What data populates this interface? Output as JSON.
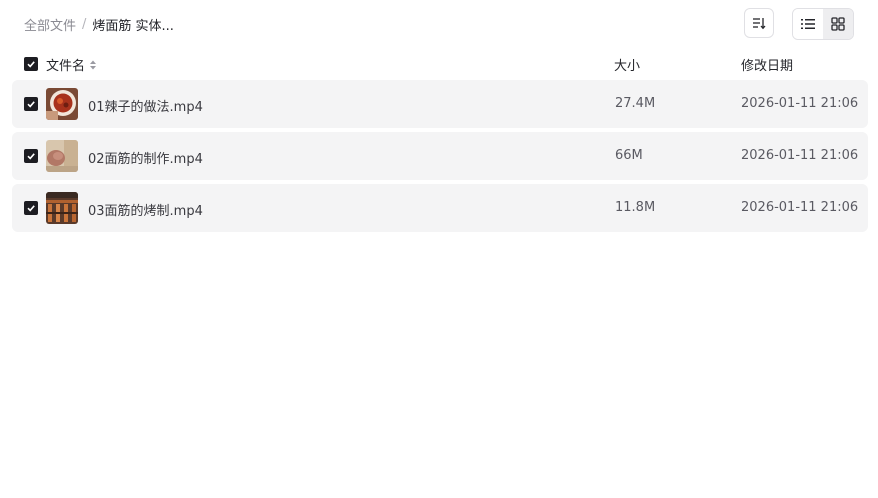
{
  "breadcrumb": {
    "root": "全部文件",
    "separator": "/",
    "current": "烤面筋 实体..."
  },
  "toolbar": {
    "sort_icon": "sort-descending-icon",
    "list_view_icon": "list-view-icon",
    "grid_view_icon": "grid-view-icon"
  },
  "header": {
    "select_all_checked": true,
    "name": "文件名",
    "size": "大小",
    "date": "修改日期"
  },
  "files": [
    {
      "name": "01辣子的做法.mp4",
      "size": "27.4M",
      "date": "2026-01-11 21:06",
      "checked": true
    },
    {
      "name": "02面筋的制作.mp4",
      "size": "66M",
      "date": "2026-01-11 21:06",
      "checked": true
    },
    {
      "name": "03面筋的烤制.mp4",
      "size": "11.8M",
      "date": "2026-01-11 21:06",
      "checked": true
    }
  ],
  "colors": {
    "row_bg": "#f4f4f5",
    "checkbox": "#1d1d22",
    "text_primary": "#25262b",
    "text_muted": "#8a8a92"
  }
}
